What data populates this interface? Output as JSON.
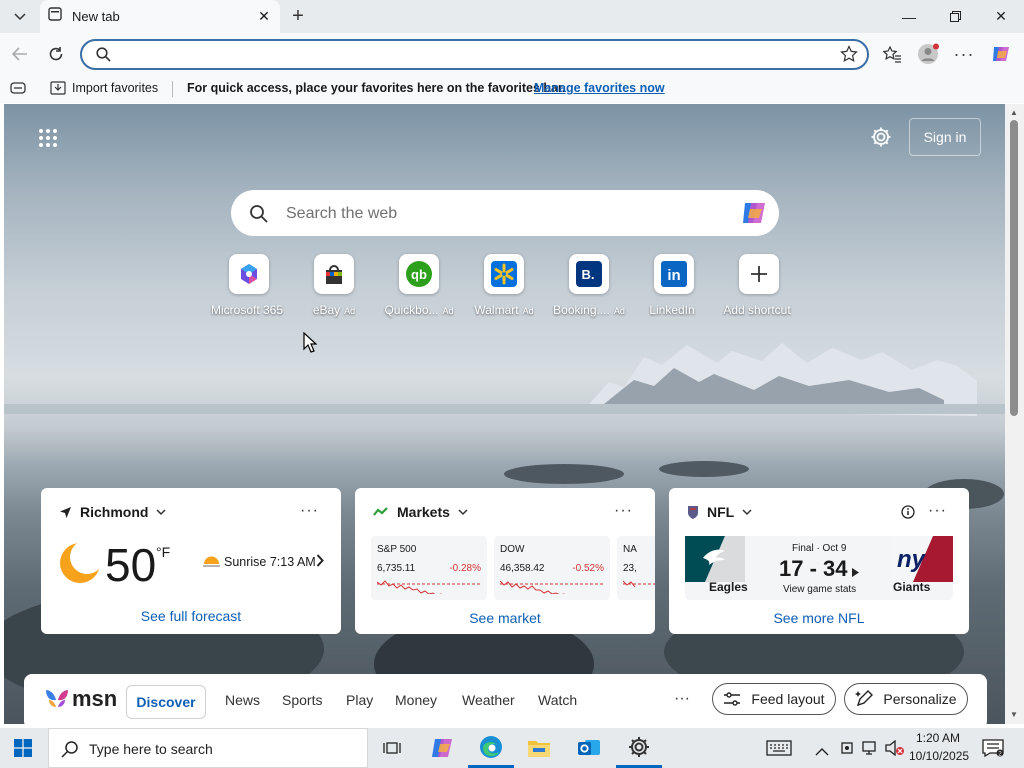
{
  "tab": {
    "title": "New tab"
  },
  "address": {
    "value": ""
  },
  "favorites_bar": {
    "import_label": "Import favorites",
    "message": "For quick access, place your favorites here on the favorites bar.",
    "manage_link": "Manage favorites now"
  },
  "header": {
    "sign_in": "Sign in"
  },
  "search": {
    "placeholder": "Search the web"
  },
  "shortcuts": [
    {
      "label": "Microsoft 365",
      "ad": "",
      "icon": "microsoft-365-icon"
    },
    {
      "label": "eBay",
      "ad": "Ad",
      "icon": "ebay-icon"
    },
    {
      "label": "Quickbo...",
      "ad": "Ad",
      "icon": "quickbooks-icon"
    },
    {
      "label": "Walmart",
      "ad": "Ad",
      "icon": "walmart-icon"
    },
    {
      "label": "Booking....",
      "ad": "Ad",
      "icon": "booking-icon"
    },
    {
      "label": "LinkedIn",
      "ad": "",
      "icon": "linkedin-icon"
    },
    {
      "label": "Add shortcut",
      "ad": "",
      "icon": "plus-icon"
    }
  ],
  "weather": {
    "location": "Richmond",
    "temp": "50",
    "unit": "°F",
    "sunrise": "Sunrise 7:13 AM",
    "link": "See full forecast"
  },
  "markets": {
    "title": "Markets",
    "items": [
      {
        "name": "S&P 500",
        "value": "6,735.11",
        "change": "-0.28%"
      },
      {
        "name": "DOW",
        "value": "46,358.42",
        "change": "-0.52%"
      },
      {
        "name": "NA",
        "value": "23,",
        "change": ""
      }
    ],
    "link": "See market"
  },
  "nfl": {
    "title": "NFL",
    "status": "Final · Oct 9",
    "score": "17 - 34",
    "stats_link": "View game stats",
    "home": "Eagles",
    "away": "Giants",
    "link": "See more NFL"
  },
  "msn": {
    "brand": "msn",
    "tabs": [
      "Discover",
      "News",
      "Sports",
      "Play",
      "Money",
      "Weather",
      "Watch"
    ],
    "more": "···",
    "feed_layout": "Feed layout",
    "personalize": "Personalize"
  },
  "taskbar": {
    "search_placeholder": "Type here to search",
    "time": "1:20 AM",
    "date": "10/10/2025"
  },
  "colors": {
    "accent": "#0f5fb5",
    "address_border": "#3a6ea5",
    "negative": "#d13438"
  }
}
